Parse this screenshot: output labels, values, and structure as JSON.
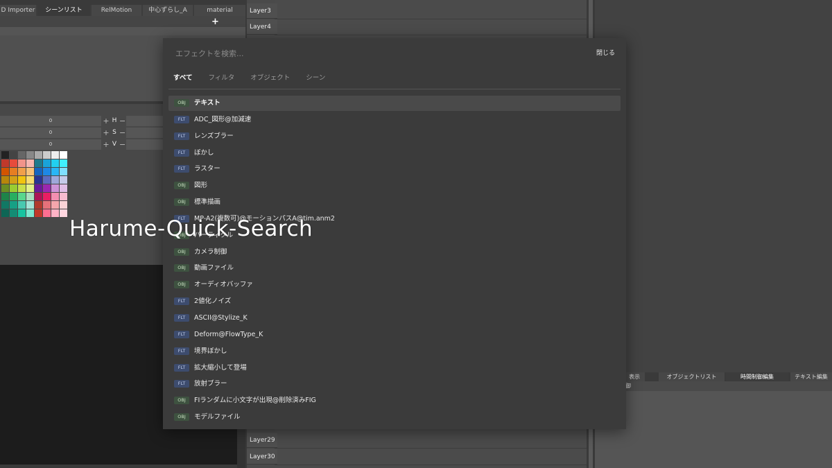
{
  "left_tabs": [
    {
      "label": "D Importer"
    },
    {
      "label": "シーンリスト",
      "active": true
    },
    {
      "label": "RelMotion"
    },
    {
      "label": "中心ずらし_A"
    },
    {
      "label": "material"
    }
  ],
  "tab_controls": {
    "add": "+",
    "minus": "−",
    "close": "✕"
  },
  "hsv": [
    {
      "value": "0",
      "label": "H"
    },
    {
      "value": "0",
      "label": "S"
    },
    {
      "value": "0",
      "label": "V"
    }
  ],
  "hsv_plus": "+",
  "hsv_minus": "−",
  "layers_top": [
    "Layer3",
    "Layer4"
  ],
  "layers_bottom": [
    "Layer29",
    "Layer30"
  ],
  "bottom_right": {
    "tabs": [
      {
        "label": "表示"
      },
      {
        "label": "オブジェクトリスト"
      },
      {
        "label": "時間制御編集",
        "active": true
      },
      {
        "label": "テキスト編集"
      }
    ],
    "subtitle": "御"
  },
  "watermark": "Harume-Quick-Search",
  "quick_search": {
    "placeholder": "エフェクトを検索...",
    "value": "",
    "close_label": "閉じる",
    "filters": [
      {
        "label": "すべて",
        "active": true
      },
      {
        "label": "フィルタ"
      },
      {
        "label": "オブジェクト"
      },
      {
        "label": "シーン"
      }
    ],
    "results": [
      {
        "badge": "OBJ",
        "name": "テキスト",
        "selected": true
      },
      {
        "badge": "FLT",
        "name": "ADC_図形@加減速"
      },
      {
        "badge": "FLT",
        "name": "レンズブラー"
      },
      {
        "badge": "FLT",
        "name": "ぼかし"
      },
      {
        "badge": "FLT",
        "name": "ラスター"
      },
      {
        "badge": "OBJ",
        "name": "図形"
      },
      {
        "badge": "OBJ",
        "name": "標準描画"
      },
      {
        "badge": "FLT",
        "name": "MP-A2(複数可)@モーションパスA@tim.anm2"
      },
      {
        "badge": "OBJ",
        "name": "パーティクル"
      },
      {
        "badge": "OBJ",
        "name": "カメラ制御"
      },
      {
        "badge": "OBJ",
        "name": "動画ファイル"
      },
      {
        "badge": "OBJ",
        "name": "オーディオバッファ"
      },
      {
        "badge": "FLT",
        "name": "2値化ノイズ"
      },
      {
        "badge": "FLT",
        "name": "ASCII@Stylize_K"
      },
      {
        "badge": "FLT",
        "name": "Deform@FlowType_K"
      },
      {
        "badge": "FLT",
        "name": "境界ぼかし"
      },
      {
        "badge": "FLT",
        "name": "拡大縮小して登場"
      },
      {
        "badge": "FLT",
        "name": "放射ブラー"
      },
      {
        "badge": "OBJ",
        "name": "FIランダムに小文字が出現@削除済みFIG"
      },
      {
        "badge": "OBJ",
        "name": "モデルファイル"
      }
    ]
  },
  "palette_colors": [
    [
      "#222222",
      "#444444",
      "#666666",
      "#888888",
      "#aaaaaa",
      "#cccccc",
      "#eeeeee",
      "#ffffff"
    ],
    [
      "#c0392b",
      "#e74c3c",
      "#f1948a",
      "#f5b7b1",
      "#1f7a8c",
      "#1aa3d9",
      "#22d0f0",
      "#40f0ff"
    ],
    [
      "#d35400",
      "#e67e22",
      "#f0a04b",
      "#f6c27a",
      "#1565c0",
      "#1e88e5",
      "#29b6f6",
      "#7fdfff"
    ],
    [
      "#b8860b",
      "#d4a017",
      "#f1c40f",
      "#f7dc6f",
      "#283593",
      "#5c6bc0",
      "#9fa8da",
      "#c5cae9"
    ],
    [
      "#6b8e23",
      "#9acd32",
      "#c8e04a",
      "#e2f08a",
      "#6a1b9a",
      "#9c27b0",
      "#ce93d8",
      "#e1bee7"
    ],
    [
      "#1e8449",
      "#27ae60",
      "#58d68d",
      "#a9dfbf",
      "#ad1457",
      "#e91e63",
      "#f48fb1",
      "#f8bbd0"
    ],
    [
      "#117864",
      "#16a085",
      "#48c9b0",
      "#a3e4d7",
      "#b03a2e",
      "#e6717a",
      "#f4a6ac",
      "#fad2d6"
    ],
    [
      "#0e6655",
      "#138d75",
      "#17c3a0",
      "#7ee8d0",
      "#c0392b",
      "#ff6f91",
      "#ffb3c6",
      "#ffd6e0"
    ]
  ]
}
